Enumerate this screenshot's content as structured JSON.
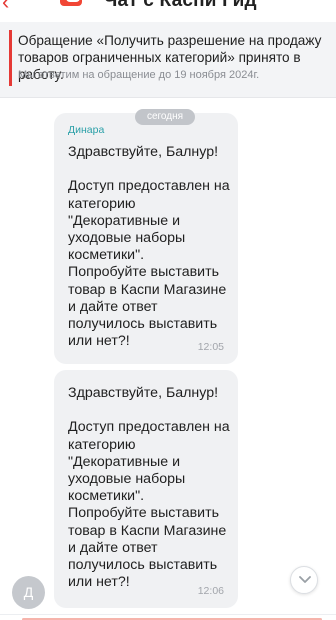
{
  "header": {
    "title": "Чат с Каспи Гид",
    "back_icon": "back-arrow-icon",
    "brand_icon": "kaspi-bag-icon",
    "accent_color": "#e53935"
  },
  "notice": {
    "text": "Обращение «Получить разрешение на продажу товаров ограниченных категорий» принято в работу.",
    "subtext": "Мы ответим на обращение до 19 ноября 2024г."
  },
  "chat": {
    "date_separator": "сегодня",
    "avatar_initial": "Д",
    "messages": [
      {
        "sender": "Динара",
        "text": "Здравствуйте, Балнур!\n\nДоступ предоставлен на категорию \"Декоративные и уходовые наборы косметики\".\nПопробуйте выставить товар в Каспи Магазине и дайте ответ получилось выставить или нет?!",
        "time": "12:05"
      },
      {
        "text": "Здравствуйте, Балнур!\n\nДоступ предоставлен на категорию \"Декоративные и уходовые наборы косметики\".\nПопробуйте выставить товар в Каспи Магазине и дайте ответ получилось выставить или нет?!",
        "time": "12:06"
      }
    ],
    "scroll_icon": "chevron-down-icon"
  }
}
